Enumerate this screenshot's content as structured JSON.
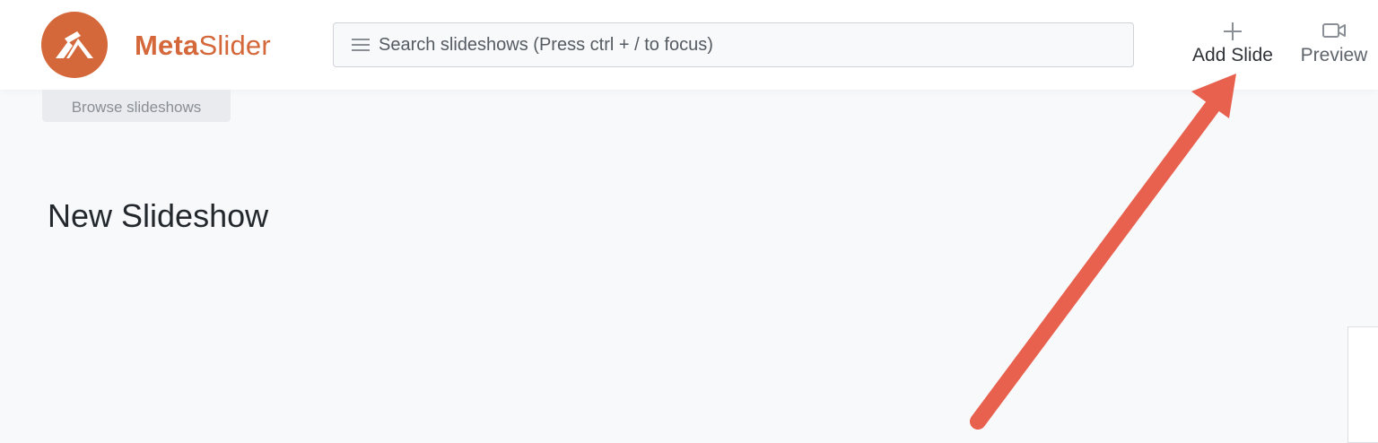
{
  "brand": {
    "name_bold": "Meta",
    "name_light": "Slider"
  },
  "search": {
    "placeholder": "Search slideshows (Press ctrl + / to focus)",
    "value": ""
  },
  "toolbar": {
    "add_slide_label": "Add Slide",
    "add_slide_icon": "plus-icon",
    "preview_label": "Preview",
    "preview_icon": "video-camera-icon"
  },
  "nav": {
    "browse_label": "Browse slideshows"
  },
  "main": {
    "title": "New Slideshow"
  },
  "colors": {
    "brand": "#d4683a",
    "annotation_arrow": "#e8604e",
    "background": "#f8f9fb"
  }
}
